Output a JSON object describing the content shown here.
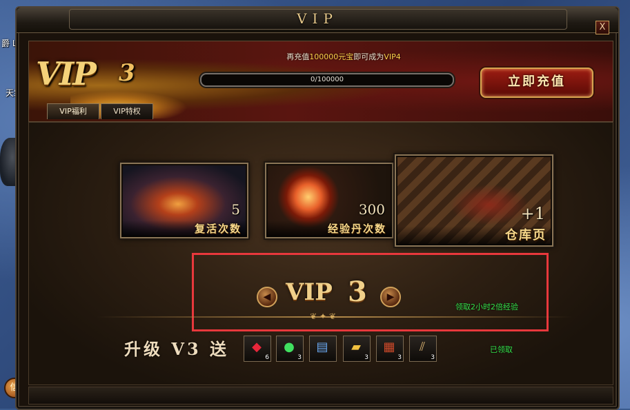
{
  "background": {
    "player_label_1": "爵 Lv",
    "player_label_2": "天霜"
  },
  "window": {
    "title": "VIP",
    "close_label": "X"
  },
  "banner": {
    "vip_logo": "VIP",
    "vip_level": "3",
    "recharge_prefix": "再充值",
    "recharge_amount": "100000元宝",
    "recharge_middle": "即可成为",
    "recharge_target": "VIP4",
    "progress_text": "0/100000",
    "progress_fraction": 0,
    "recharge_button": "立即充值",
    "tabs": [
      {
        "label": "VIP福利",
        "active": true
      },
      {
        "label": "VIP特权",
        "active": false
      }
    ]
  },
  "cards": [
    {
      "count": "5",
      "label": "复活次数",
      "icon": "revive-flame-icon"
    },
    {
      "count": "300",
      "label": "经验丹次数",
      "icon": "exp-orb-icon"
    },
    {
      "count": "+1",
      "label": "仓库页",
      "icon": "warehouse-icon"
    }
  ],
  "level_selector": {
    "label": "VIP",
    "level": "3",
    "prev_icon": "chevron-left-icon",
    "next_icon": "chevron-right-icon",
    "bonus_text": "领取2小时2倍经验"
  },
  "upgrade_rewards": {
    "label": "升级 V3 送",
    "items": [
      {
        "icon": "red-gem-icon",
        "qty": "6"
      },
      {
        "icon": "exp-pill-icon",
        "qty": "3"
      },
      {
        "icon": "exp-scroll-icon",
        "qty": ""
      },
      {
        "icon": "gold-ingot-icon",
        "qty": "3"
      },
      {
        "icon": "book-icon",
        "qty": "3"
      },
      {
        "icon": "scroll-bundle-icon",
        "qty": "3"
      }
    ],
    "status": "已领取"
  },
  "colors": {
    "accent_gold": "#f0d08a",
    "highlight_red": "#e8383c",
    "status_green": "#35e04a"
  }
}
